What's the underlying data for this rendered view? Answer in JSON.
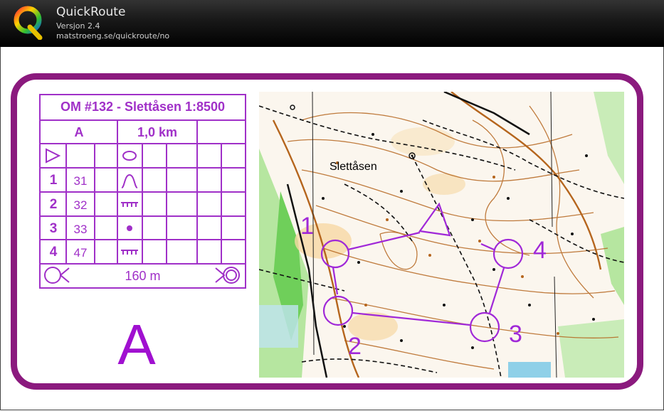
{
  "window": {
    "title": "QuickRoute",
    "version": "Versjon 2.4",
    "url": "matstroeng.se/quickroute/no"
  },
  "description": {
    "header": "OM #132 - Slettåsen 1:8500",
    "course": "A",
    "length": "1,0 km",
    "controls": [
      {
        "number": "1",
        "code": "31",
        "symbol": "hill-icon"
      },
      {
        "number": "2",
        "code": "32",
        "symbol": "cliff-icon"
      },
      {
        "number": "3",
        "code": "33",
        "symbol": "dot-icon"
      },
      {
        "number": "4",
        "code": "47",
        "symbol": "cliff-icon"
      }
    ],
    "finish_distance": "160 m"
  },
  "course_letter": "A",
  "map": {
    "place_name": "Slettåsen",
    "control_labels": [
      "1",
      "2",
      "3",
      "4"
    ],
    "course_color": "#a028d8"
  },
  "colors": {
    "frame": "#8b1a7e",
    "purple": "#a030c8"
  }
}
